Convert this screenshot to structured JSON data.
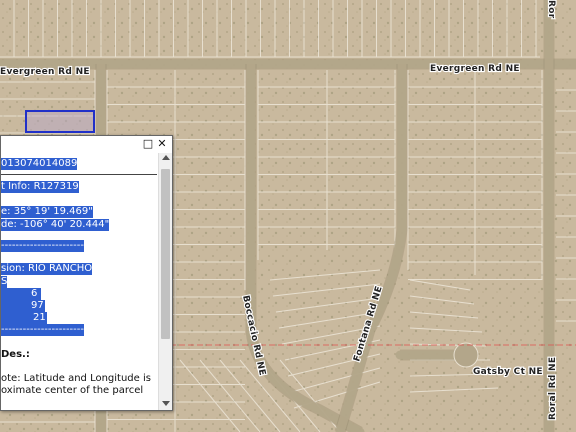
{
  "map": {
    "roads": {
      "evergreen_left": "Evergreen Rd NE",
      "evergreen_right": "Evergreen Rd NE",
      "boccacio": "Boccacio Rd NE",
      "fontana": "Fontana Rd NE",
      "gatsby": "Gatsby Ct NE",
      "roral": "Roral Rd NE",
      "top_right": "Ror"
    }
  },
  "popup": {
    "lines": [
      "013074014089",
      "t Info: R127319",
      "e: 35° 19' 19.469\"",
      "de: -106° 40' 20.444\"",
      "-----------------------",
      "sion: RIO RANCHO",
      "S",
      "6",
      "97",
      "21",
      "-----------------------",
      "Des.:",
      "ote: Latitude and Longitude is",
      "oximate center of the parcel"
    ],
    "icons": {
      "maximize": "maximize-icon",
      "close": "close-icon"
    }
  },
  "colors": {
    "highlight": "#2f5fd0",
    "selected_parcel": "#2030c8"
  }
}
